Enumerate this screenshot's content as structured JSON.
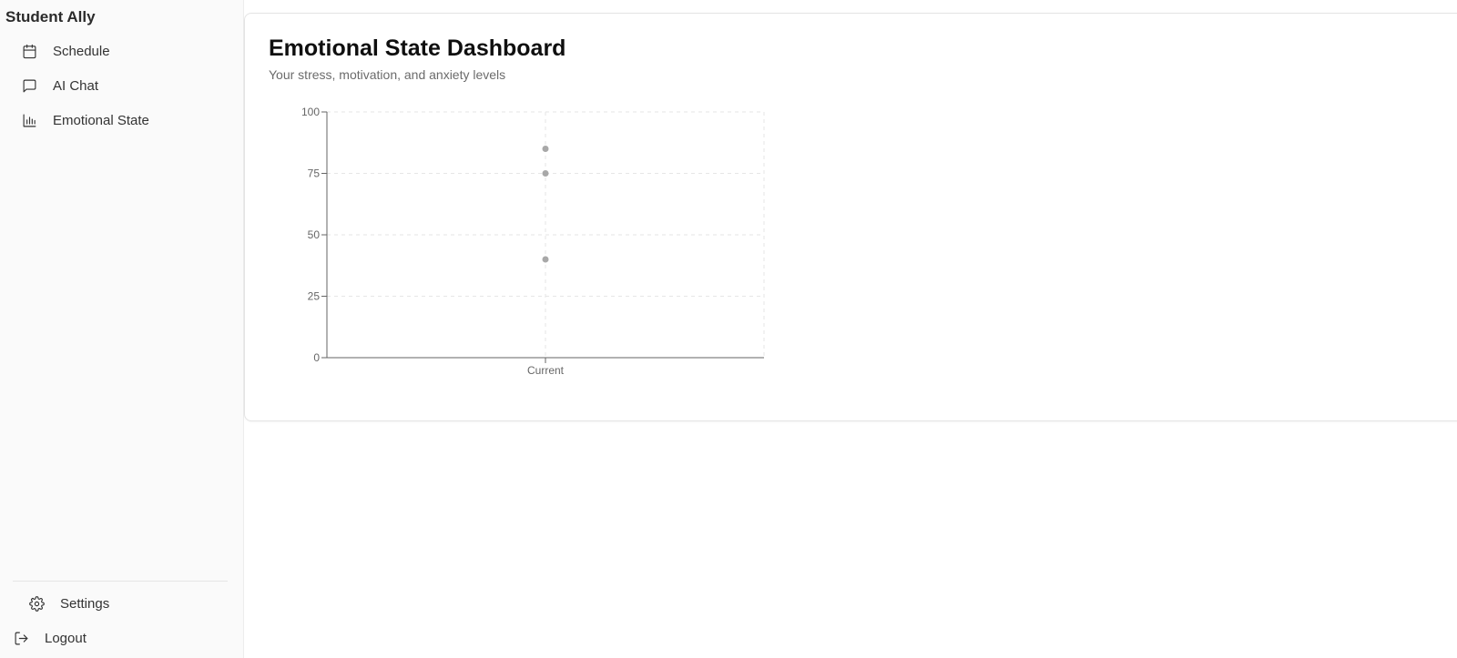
{
  "sidebar": {
    "brand": "Student Ally",
    "items": [
      {
        "label": "Schedule",
        "icon": "calendar-icon"
      },
      {
        "label": "AI Chat",
        "icon": "message-square-icon"
      },
      {
        "label": "Emotional State",
        "icon": "bar-chart-icon"
      }
    ],
    "bottom_items": [
      {
        "label": "Settings",
        "icon": "gear-icon"
      },
      {
        "label": "Logout",
        "icon": "logout-icon"
      }
    ]
  },
  "main": {
    "title": "Emotional State Dashboard",
    "subtitle": "Your stress, motivation, and anxiety levels"
  },
  "colors": {
    "point": "#a8a8a8",
    "axis": "#666666",
    "grid": "#e6e6e6"
  },
  "chart_data": {
    "type": "scatter",
    "categories": [
      "Current"
    ],
    "series": [
      {
        "values": [
          85
        ]
      },
      {
        "values": [
          75
        ]
      },
      {
        "values": [
          40
        ]
      }
    ],
    "yticks": [
      0,
      25,
      50,
      75,
      100
    ],
    "ylim": [
      0,
      100
    ],
    "grid": true,
    "title": "",
    "xlabel": "",
    "ylabel": ""
  }
}
